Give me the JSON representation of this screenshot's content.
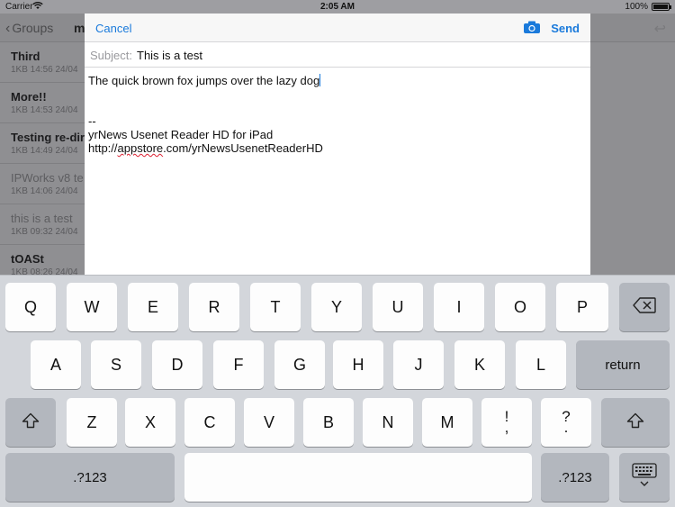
{
  "status_bar": {
    "carrier": "Carrier",
    "time": "2:05 AM",
    "battery_percent": "100%",
    "battery_level": 1.0
  },
  "background": {
    "back_label": "Groups",
    "title_partial": "m",
    "messages": [
      {
        "title": "Third",
        "meta": "1KB  14:56 24/04",
        "read": false
      },
      {
        "title": "More!!",
        "meta": "1KB  14:53 24/04",
        "read": false
      },
      {
        "title": "Testing re-dir",
        "meta": "1KB  14:49 24/04",
        "read": false
      },
      {
        "title": "IPWorks v8 te",
        "meta": "1KB  14:06 24/04",
        "read": true
      },
      {
        "title": "this is a test",
        "meta": "1KB  09:32 24/04",
        "read": true
      },
      {
        "title": "tOASt",
        "meta": "1KB  08:26 24/04",
        "read": false
      }
    ]
  },
  "compose": {
    "cancel_label": "Cancel",
    "send_label": "Send",
    "subject_label": "Subject:",
    "subject_value": "This is a test",
    "body_first_line": "The quick brown fox jumps over the lazy dog",
    "signature_separator": "--",
    "signature_line1": "yrNews Usenet Reader HD for iPad",
    "signature_url_prefix": "http://",
    "signature_url_misspelled": "appstore",
    "signature_url_suffix": ".com/yrNewsUsenetReaderHD",
    "accent_color": "#1a7adb"
  },
  "keyboard": {
    "row1": [
      "Q",
      "W",
      "E",
      "R",
      "T",
      "Y",
      "U",
      "I",
      "O",
      "P"
    ],
    "row2": [
      "A",
      "S",
      "D",
      "F",
      "G",
      "H",
      "J",
      "K",
      "L"
    ],
    "row3": [
      "Z",
      "X",
      "C",
      "V",
      "B",
      "N",
      "M"
    ],
    "exclaim_top": "!",
    "exclaim_bottom": ",",
    "question_top": "?",
    "question_bottom": ".",
    "return_label": "return",
    "numbers_label": ".?123",
    "backspace_icon": "backspace-icon",
    "shift_icon": "shift-icon",
    "dismiss_icon": "keyboard-dismiss-icon"
  }
}
